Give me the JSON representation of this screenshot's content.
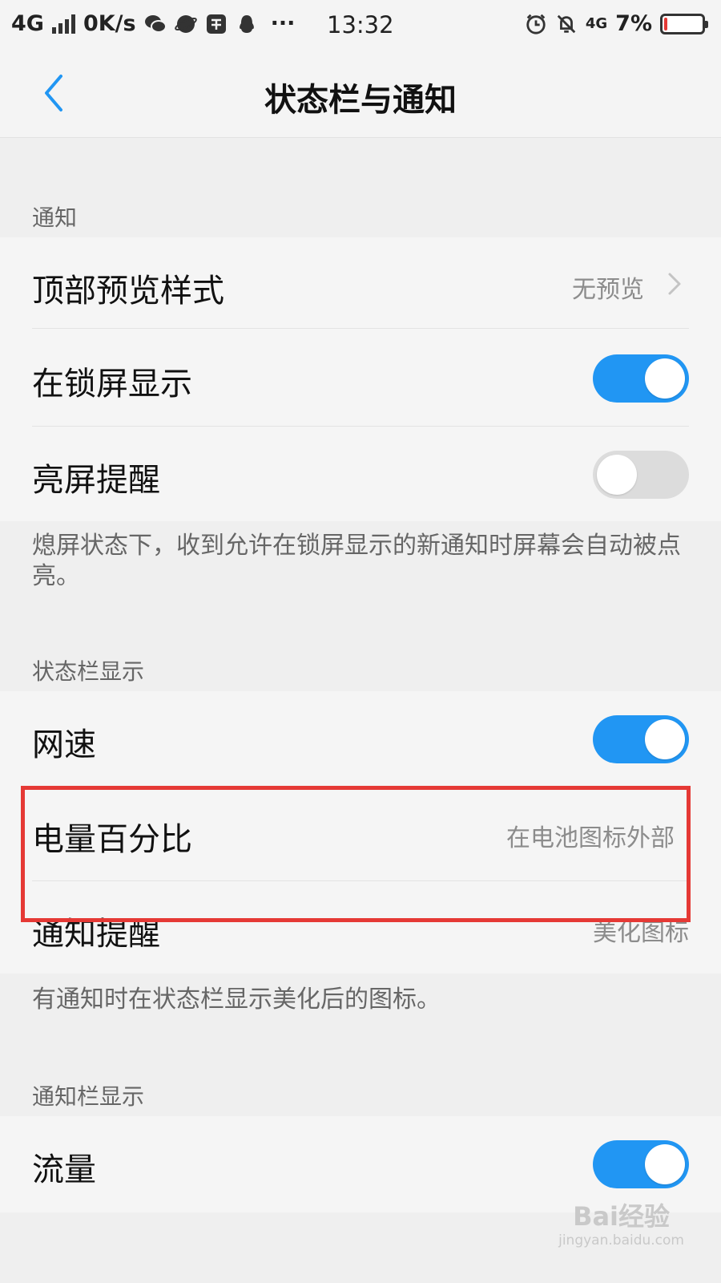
{
  "status_bar": {
    "network": "4G",
    "speed": "0K/s",
    "more": "···",
    "time": "13:32",
    "network_right": "4G",
    "battery_text": "7%",
    "battery_level": 0.07,
    "icons": [
      "signal-icon",
      "wechat-icon",
      "browser-icon",
      "app-icon",
      "qq-icon",
      "alarm-icon",
      "mute-icon",
      "battery-icon"
    ]
  },
  "header": {
    "title": "状态栏与通知",
    "back_icon": "chevron-left-icon"
  },
  "sections": {
    "notification": {
      "header": "通知",
      "preview_style": {
        "label": "顶部预览样式",
        "value": "无预览"
      },
      "lockscreen": {
        "label": "在锁屏显示",
        "enabled": true
      },
      "wake_screen": {
        "label": "亮屏提醒",
        "enabled": false
      },
      "description": "熄屏状态下，收到允许在锁屏显示的新通知时屏幕会自动被点亮。"
    },
    "statusbar": {
      "header": "状态栏显示",
      "net_speed": {
        "label": "网速",
        "enabled": true
      },
      "battery_percent": {
        "label": "电量百分比",
        "value": "在电池图标外部"
      },
      "notify_icon": {
        "label": "通知提醒",
        "value": "美化图标"
      },
      "description": "有通知时在状态栏显示美化后的图标。"
    },
    "notification_bar": {
      "header": "通知栏显示",
      "traffic": {
        "label": "流量",
        "enabled": true
      }
    }
  },
  "watermark": {
    "main": "Bai经验",
    "sub": "jingyan.baidu.com"
  },
  "colors": {
    "accent": "#2196f3",
    "highlight": "#e53935",
    "background": "#efefef"
  }
}
